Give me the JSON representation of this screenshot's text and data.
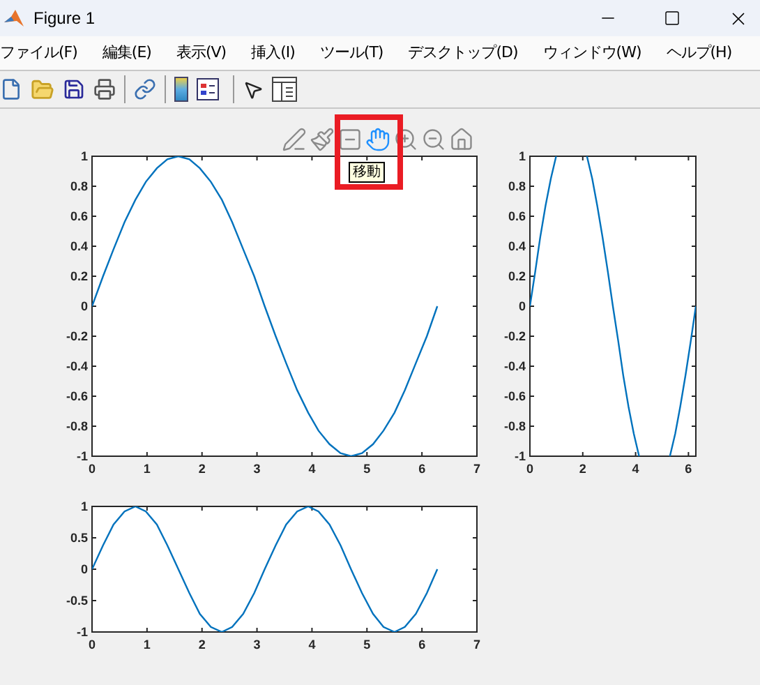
{
  "window": {
    "title": "Figure 1"
  },
  "menu": [
    {
      "label": "ファイル(F)"
    },
    {
      "label": "編集(E)"
    },
    {
      "label": "表示(V)"
    },
    {
      "label": "挿入(I)"
    },
    {
      "label": "ツール(T)"
    },
    {
      "label": "デスクトップ(D)"
    },
    {
      "label": "ウィンドウ(W)"
    },
    {
      "label": "ヘルプ(H)"
    }
  ],
  "axes_toolbar": [
    {
      "selected": false
    },
    {
      "selected": false
    },
    {
      "selected": false
    },
    {
      "selected": true
    },
    {
      "selected": false
    },
    {
      "selected": false
    },
    {
      "selected": false
    }
  ],
  "tooltip": "移動",
  "axes": [
    {
      "chart_data": {
        "type": "line",
        "x": [
          0,
          0.2,
          0.39,
          0.59,
          0.79,
          0.98,
          1.18,
          1.37,
          1.57,
          1.77,
          1.96,
          2.16,
          2.36,
          2.55,
          2.75,
          2.95,
          3.14,
          3.34,
          3.53,
          3.73,
          3.93,
          4.12,
          4.32,
          4.52,
          4.71,
          4.91,
          5.11,
          5.3,
          5.5,
          5.69,
          5.89,
          6.09,
          6.28
        ],
        "series": [
          {
            "color": "#0072bd",
            "values": [
              0,
              0.2,
              0.38,
              0.56,
              0.71,
              0.83,
              0.92,
              0.98,
              1,
              0.98,
              0.92,
              0.83,
              0.71,
              0.56,
              0.38,
              0.2,
              0,
              -0.2,
              -0.38,
              -0.56,
              -0.71,
              -0.83,
              -0.92,
              -0.98,
              -1,
              -0.98,
              -0.92,
              -0.83,
              -0.71,
              -0.56,
              -0.38,
              -0.2,
              0
            ]
          }
        ],
        "xlim": [
          0,
          7
        ],
        "ylim": [
          -1,
          1
        ],
        "xticks": [
          0,
          1,
          2,
          3,
          4,
          5,
          6,
          7
        ],
        "yticks": [
          -1,
          -0.8,
          -0.6,
          -0.4,
          -0.2,
          0,
          0.2,
          0.4,
          0.6,
          0.8,
          1
        ]
      }
    },
    {
      "chart_data": {
        "type": "line",
        "x": [
          0,
          0.2,
          0.39,
          0.59,
          0.79,
          0.99,
          2.16,
          2.36,
          2.55,
          2.75,
          2.95,
          3.14,
          3.34,
          3.53,
          3.73,
          3.93,
          4.13,
          5.3,
          5.5,
          5.69,
          5.89,
          6.09,
          6.28
        ],
        "series": [
          {
            "color": "#0072bd",
            "values": [
              0,
              0.23,
              0.46,
              0.67,
              0.85,
              1,
              1,
              0.85,
              0.67,
              0.46,
              0.23,
              0,
              -0.23,
              -0.46,
              -0.67,
              -0.85,
              -1,
              -1,
              -0.85,
              -0.67,
              -0.46,
              -0.23,
              0
            ]
          }
        ],
        "xlim": [
          0,
          6.28
        ],
        "ylim": [
          -1,
          1
        ],
        "xticks": [
          0,
          2,
          4,
          6
        ],
        "yticks": [
          -1,
          -0.8,
          -0.6,
          -0.4,
          -0.2,
          0,
          0.2,
          0.4,
          0.6,
          0.8,
          1
        ]
      }
    },
    {
      "chart_data": {
        "type": "line",
        "x": [
          0,
          0.2,
          0.39,
          0.59,
          0.79,
          0.98,
          1.18,
          1.37,
          1.57,
          1.77,
          1.96,
          2.16,
          2.36,
          2.55,
          2.75,
          2.95,
          3.14,
          3.34,
          3.53,
          3.73,
          3.93,
          4.12,
          4.32,
          4.52,
          4.71,
          4.91,
          5.11,
          5.3,
          5.5,
          5.69,
          5.89,
          6.09,
          6.28
        ],
        "series": [
          {
            "color": "#0072bd",
            "values": [
              0,
              0.38,
              0.71,
              0.92,
              1,
              0.92,
              0.71,
              0.38,
              0,
              -0.38,
              -0.71,
              -0.92,
              -1,
              -0.92,
              -0.71,
              -0.38,
              0,
              0.38,
              0.71,
              0.92,
              1,
              0.92,
              0.71,
              0.38,
              0,
              -0.38,
              -0.71,
              -0.92,
              -1,
              -0.92,
              -0.71,
              -0.38,
              0
            ]
          }
        ],
        "xlim": [
          0,
          7
        ],
        "ylim": [
          -1,
          1
        ],
        "xticks": [
          0,
          1,
          2,
          3,
          4,
          5,
          6,
          7
        ],
        "yticks": [
          -1,
          -0.5,
          0,
          0.5,
          1
        ]
      }
    }
  ]
}
